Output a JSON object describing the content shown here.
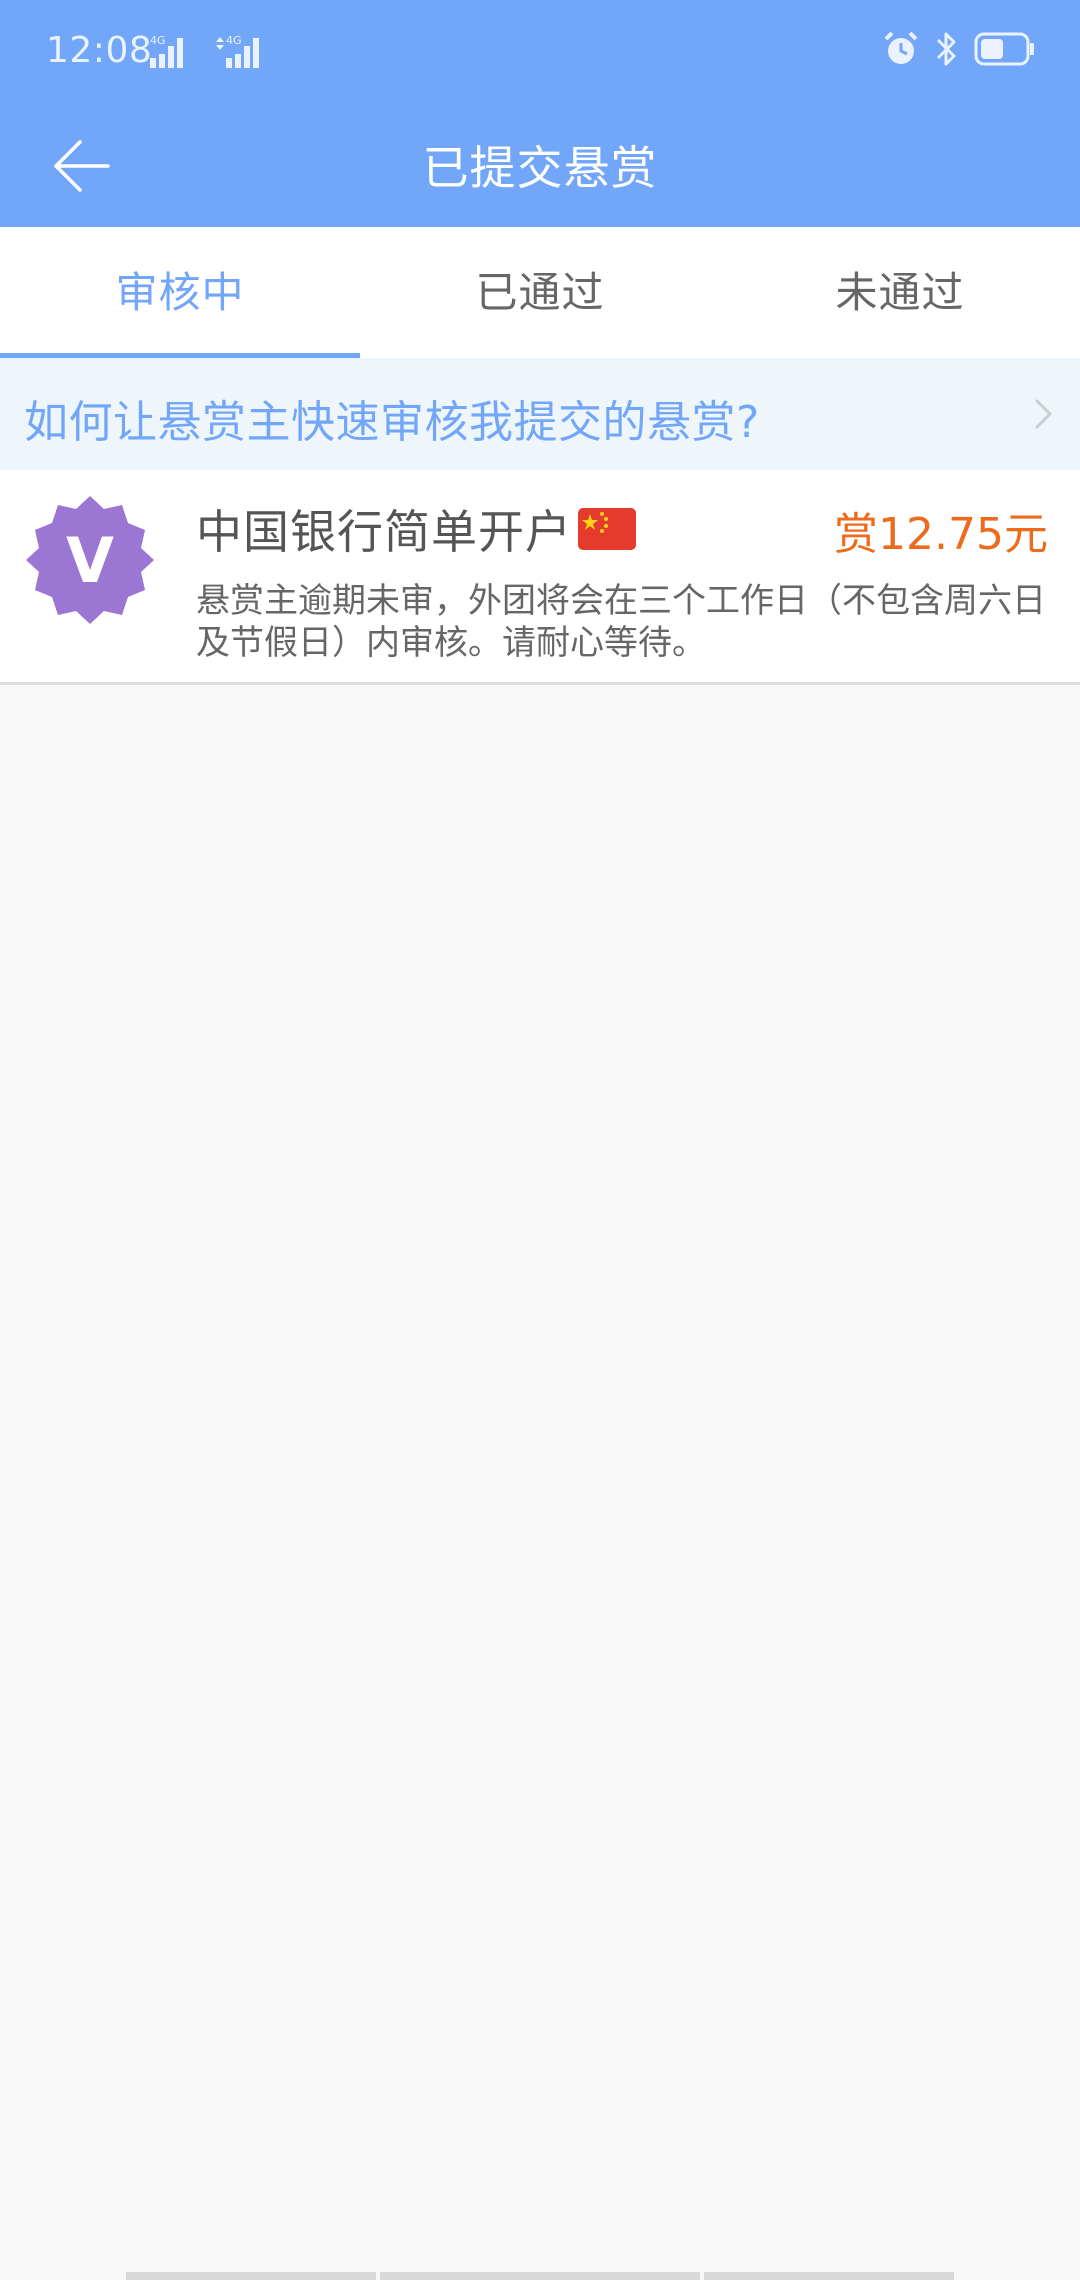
{
  "status_bar": {
    "time": "12:08",
    "network_1": "4G",
    "network_2": "4G"
  },
  "toolbar": {
    "title": "已提交悬赏"
  },
  "tabs": [
    {
      "label": "审核中",
      "active": true
    },
    {
      "label": "已通过",
      "active": false
    },
    {
      "label": "未通过",
      "active": false
    }
  ],
  "tip": {
    "text": "如何让悬赏主快速审核我提交的悬赏?"
  },
  "items": [
    {
      "avatar_letter": "V",
      "title": "中国银行简单开户",
      "reward": "赏12.75元",
      "description": "悬赏主逾期未审，外团将会在三个工作日（不包含周六日及节假日）内审核。请耐心等待。"
    }
  ],
  "colors": {
    "header": "#72a6f9",
    "accent": "#72a6f9",
    "reward": "#ee6a1c",
    "avatar": "#9b77d3"
  },
  "icons": {
    "back": "arrow-left-icon",
    "chevron": "chevron-right-icon",
    "alarm": "alarm-icon",
    "bluetooth": "bluetooth-icon",
    "battery": "battery-icon",
    "flag": "china-flag-icon"
  }
}
